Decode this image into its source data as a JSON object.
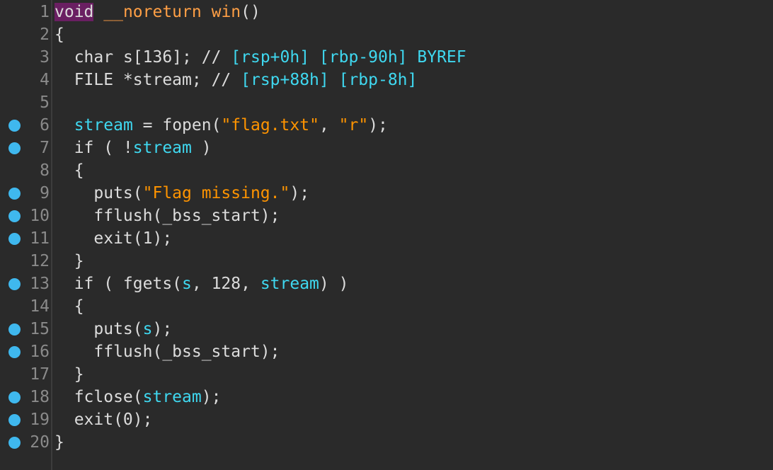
{
  "editor": {
    "colors": {
      "background": "#2a2a2a",
      "breakpoint": "#3fb8ee",
      "function_name": "#ff9f45",
      "variable": "#3fd8f0",
      "string": "#ff9400",
      "keyword_highlight": "#6a1f62"
    },
    "lines": [
      {
        "num": "1",
        "bp": false,
        "tokens": [
          {
            "t": "void",
            "c": "kw-hl"
          },
          {
            "t": " ",
            "c": "plain"
          },
          {
            "t": "__noreturn",
            "c": "fn"
          },
          {
            "t": " ",
            "c": "plain"
          },
          {
            "t": "win",
            "c": "fn"
          },
          {
            "t": "()",
            "c": "plain"
          }
        ]
      },
      {
        "num": "2",
        "bp": false,
        "tokens": [
          {
            "t": "{",
            "c": "plain"
          }
        ]
      },
      {
        "num": "3",
        "bp": false,
        "tokens": [
          {
            "t": "  char ",
            "c": "plain"
          },
          {
            "t": "s",
            "c": "plain"
          },
          {
            "t": "[136]; // ",
            "c": "plain"
          },
          {
            "t": "[rsp+0h] [rbp-90h] BYREF",
            "c": "var"
          }
        ]
      },
      {
        "num": "4",
        "bp": false,
        "tokens": [
          {
            "t": "  FILE *",
            "c": "plain"
          },
          {
            "t": "stream",
            "c": "plain"
          },
          {
            "t": "; // ",
            "c": "plain"
          },
          {
            "t": "[rsp+88h] [rbp-8h]",
            "c": "var"
          }
        ]
      },
      {
        "num": "5",
        "bp": false,
        "tokens": [
          {
            "t": "",
            "c": "plain"
          }
        ]
      },
      {
        "num": "6",
        "bp": true,
        "tokens": [
          {
            "t": "  ",
            "c": "plain"
          },
          {
            "t": "stream",
            "c": "var"
          },
          {
            "t": " = ",
            "c": "plain"
          },
          {
            "t": "fopen",
            "c": "plain"
          },
          {
            "t": "(",
            "c": "plain"
          },
          {
            "t": "\"flag.txt\"",
            "c": "str"
          },
          {
            "t": ", ",
            "c": "plain"
          },
          {
            "t": "\"r\"",
            "c": "str"
          },
          {
            "t": ");",
            "c": "plain"
          }
        ]
      },
      {
        "num": "7",
        "bp": true,
        "tokens": [
          {
            "t": "  if ( !",
            "c": "plain"
          },
          {
            "t": "stream",
            "c": "var"
          },
          {
            "t": " )",
            "c": "plain"
          }
        ]
      },
      {
        "num": "8",
        "bp": false,
        "tokens": [
          {
            "t": "  {",
            "c": "plain"
          }
        ]
      },
      {
        "num": "9",
        "bp": true,
        "tokens": [
          {
            "t": "    puts(",
            "c": "plain"
          },
          {
            "t": "\"Flag missing.\"",
            "c": "str"
          },
          {
            "t": ");",
            "c": "plain"
          }
        ]
      },
      {
        "num": "10",
        "bp": true,
        "tokens": [
          {
            "t": "    fflush(_bss_start);",
            "c": "plain"
          }
        ]
      },
      {
        "num": "11",
        "bp": true,
        "tokens": [
          {
            "t": "    exit(1);",
            "c": "plain"
          }
        ]
      },
      {
        "num": "12",
        "bp": false,
        "tokens": [
          {
            "t": "  }",
            "c": "plain"
          }
        ]
      },
      {
        "num": "13",
        "bp": true,
        "tokens": [
          {
            "t": "  if ( fgets(",
            "c": "plain"
          },
          {
            "t": "s",
            "c": "var"
          },
          {
            "t": ", 128, ",
            "c": "plain"
          },
          {
            "t": "stream",
            "c": "var"
          },
          {
            "t": ") )",
            "c": "plain"
          }
        ]
      },
      {
        "num": "14",
        "bp": false,
        "tokens": [
          {
            "t": "  {",
            "c": "plain"
          }
        ]
      },
      {
        "num": "15",
        "bp": true,
        "tokens": [
          {
            "t": "    puts(",
            "c": "plain"
          },
          {
            "t": "s",
            "c": "var"
          },
          {
            "t": ");",
            "c": "plain"
          }
        ]
      },
      {
        "num": "16",
        "bp": true,
        "tokens": [
          {
            "t": "    fflush(_bss_start);",
            "c": "plain"
          }
        ]
      },
      {
        "num": "17",
        "bp": false,
        "tokens": [
          {
            "t": "  }",
            "c": "plain"
          }
        ]
      },
      {
        "num": "18",
        "bp": true,
        "tokens": [
          {
            "t": "  fclose(",
            "c": "plain"
          },
          {
            "t": "stream",
            "c": "var"
          },
          {
            "t": ");",
            "c": "plain"
          }
        ]
      },
      {
        "num": "19",
        "bp": true,
        "tokens": [
          {
            "t": "  exit(0);",
            "c": "plain"
          }
        ]
      },
      {
        "num": "20",
        "bp": true,
        "tokens": [
          {
            "t": "}",
            "c": "plain"
          }
        ]
      }
    ]
  }
}
